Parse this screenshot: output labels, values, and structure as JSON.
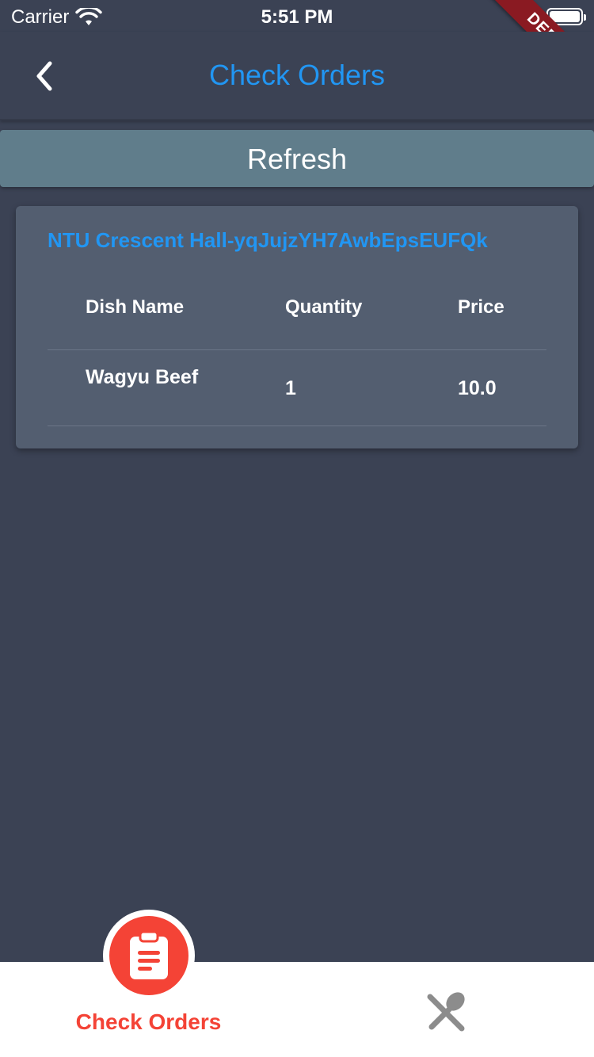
{
  "status_bar": {
    "carrier": "Carrier",
    "time": "5:51 PM",
    "wifi_icon": "wifi-icon",
    "battery_icon": "battery-icon"
  },
  "debug_banner": "DEBUG",
  "app_bar": {
    "title": "Check Orders",
    "back_icon": "chevron-left-icon"
  },
  "refresh_button": {
    "label": "Refresh"
  },
  "orders": [
    {
      "title": "NTU Crescent Hall-yqJujzYH7AwbEpsEUFQk",
      "columns": [
        "Dish Name",
        "Quantity",
        "Price"
      ],
      "rows": [
        {
          "dish_name": "Wagyu Beef",
          "quantity": "1",
          "price": "10.0"
        }
      ]
    }
  ],
  "bottom_nav": {
    "items": [
      {
        "label": "Check Orders",
        "icon": "clipboard-icon",
        "active": true
      },
      {
        "label": "",
        "icon": "utensils-icon",
        "active": false
      }
    ]
  },
  "colors": {
    "background": "#3b4254",
    "accent_blue": "#2196f3",
    "accent_red": "#f44336",
    "refresh_bg": "#607d8b",
    "card_bg": "#535e70"
  }
}
